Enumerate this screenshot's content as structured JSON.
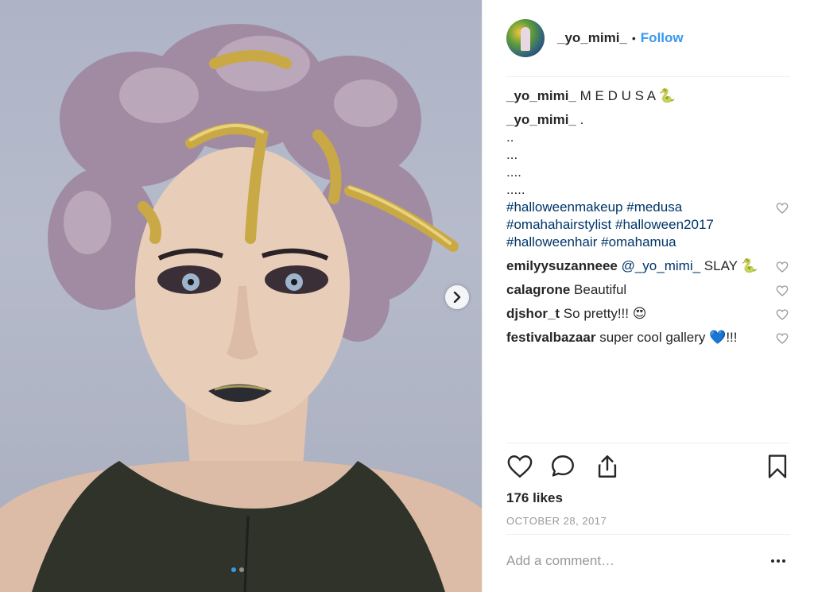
{
  "author": {
    "username": "_yo_mimi_",
    "separator": "•",
    "follow_label": "Follow"
  },
  "caption": {
    "username": "_yo_mimi_",
    "text": "M E D U S A 🐍"
  },
  "caption_comment": {
    "username": "_yo_mimi_",
    "lines": [
      ".",
      "..",
      "...",
      "....",
      "....."
    ],
    "hashtags_line1": [
      "#halloweenmakeup",
      "#medusa"
    ],
    "hashtags_line2": [
      "#omahahairstylist",
      "#halloween2017"
    ],
    "hashtags_line3": [
      "#halloweenhair",
      "#omahamua"
    ]
  },
  "comments": [
    {
      "username": "emilyysuzanneee",
      "mention": "@_yo_mimi_",
      "text": "SLAY 🐍"
    },
    {
      "username": "calagrone",
      "text": "Beautiful"
    },
    {
      "username": "djshor_t",
      "text": "So pretty!!! 😍"
    },
    {
      "username": "festivalbazaar",
      "text": "super cool gallery 💙!!!"
    }
  ],
  "likes": "176 likes",
  "date": "OCTOBER 28, 2017",
  "add_comment_placeholder": "Add a comment…",
  "icons": {
    "like": "heart-icon",
    "comment": "comment-icon",
    "share": "share-icon",
    "save": "bookmark-icon",
    "more": "more-options-icon",
    "next": "chevron-right-icon"
  },
  "colors": {
    "link": "#3897f0",
    "hashtag": "#003569",
    "muted": "#999999",
    "text": "#262626"
  },
  "carousel": {
    "slides": 2,
    "active": 1
  }
}
